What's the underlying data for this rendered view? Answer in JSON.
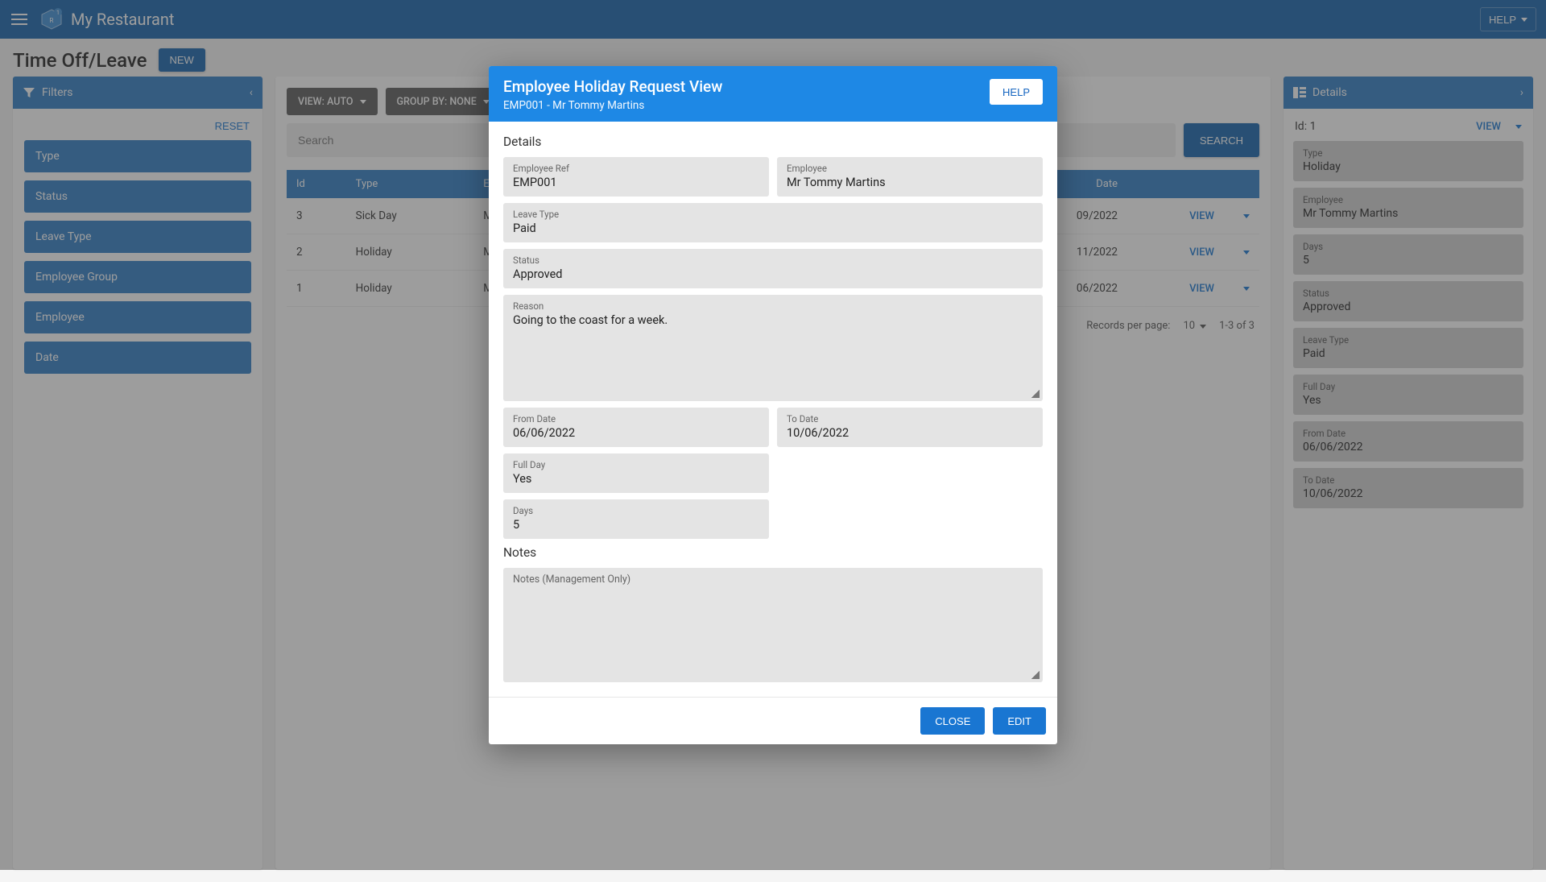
{
  "topbar": {
    "app_name": "My Restaurant",
    "help_label": "HELP"
  },
  "page": {
    "title": "Time Off/Leave",
    "new_label": "NEW"
  },
  "filters": {
    "header": "Filters",
    "reset_label": "RESET",
    "items": [
      "Type",
      "Status",
      "Leave Type",
      "Employee Group",
      "Employee",
      "Date"
    ]
  },
  "center": {
    "view_chip": "VIEW: AUTO",
    "group_chip": "GROUP BY: NONE",
    "search_placeholder": "Search",
    "search_btn": "SEARCH",
    "columns": [
      "Id",
      "Type",
      "Employee",
      "Date"
    ],
    "rows": [
      {
        "id": "3",
        "type": "Sick Day",
        "employee": "Miss A",
        "date": "09/2022",
        "action": "VIEW"
      },
      {
        "id": "2",
        "type": "Holiday",
        "employee": "Mr Tom",
        "date": "11/2022",
        "action": "VIEW"
      },
      {
        "id": "1",
        "type": "Holiday",
        "employee": "Mr Tom",
        "date": "06/2022",
        "action": "VIEW"
      }
    ],
    "pager": {
      "rpp_label": "Records per page:",
      "rpp_value": "10",
      "range": "1-3 of 3"
    }
  },
  "details": {
    "header": "Details",
    "id_line": "Id: 1",
    "view_label": "VIEW",
    "cards": [
      {
        "label": "Type",
        "value": "Holiday"
      },
      {
        "label": "Employee",
        "value": "Mr Tommy Martins"
      },
      {
        "label": "Days",
        "value": "5"
      },
      {
        "label": "Status",
        "value": "Approved"
      },
      {
        "label": "Leave Type",
        "value": "Paid"
      },
      {
        "label": "Full Day",
        "value": "Yes"
      },
      {
        "label": "From Date",
        "value": "06/06/2022"
      },
      {
        "label": "To Date",
        "value": "10/06/2022"
      }
    ]
  },
  "modal": {
    "title": "Employee Holiday Request View",
    "subtitle": "EMP001 - Mr Tommy Martins",
    "help_label": "HELP",
    "section_details": "Details",
    "section_notes": "Notes",
    "fields": {
      "employee_ref": {
        "label": "Employee Ref",
        "value": "EMP001"
      },
      "employee": {
        "label": "Employee",
        "value": "Mr Tommy Martins"
      },
      "leave_type": {
        "label": "Leave Type",
        "value": "Paid"
      },
      "status": {
        "label": "Status",
        "value": "Approved"
      },
      "reason": {
        "label": "Reason",
        "value": "Going to the coast for a week."
      },
      "from_date": {
        "label": "From Date",
        "value": "06/06/2022"
      },
      "to_date": {
        "label": "To Date",
        "value": "10/06/2022"
      },
      "full_day": {
        "label": "Full Day",
        "value": "Yes"
      },
      "days": {
        "label": "Days",
        "value": "5"
      },
      "notes": {
        "label": "Notes (Management Only)",
        "value": ""
      }
    },
    "close_label": "CLOSE",
    "edit_label": "EDIT"
  }
}
